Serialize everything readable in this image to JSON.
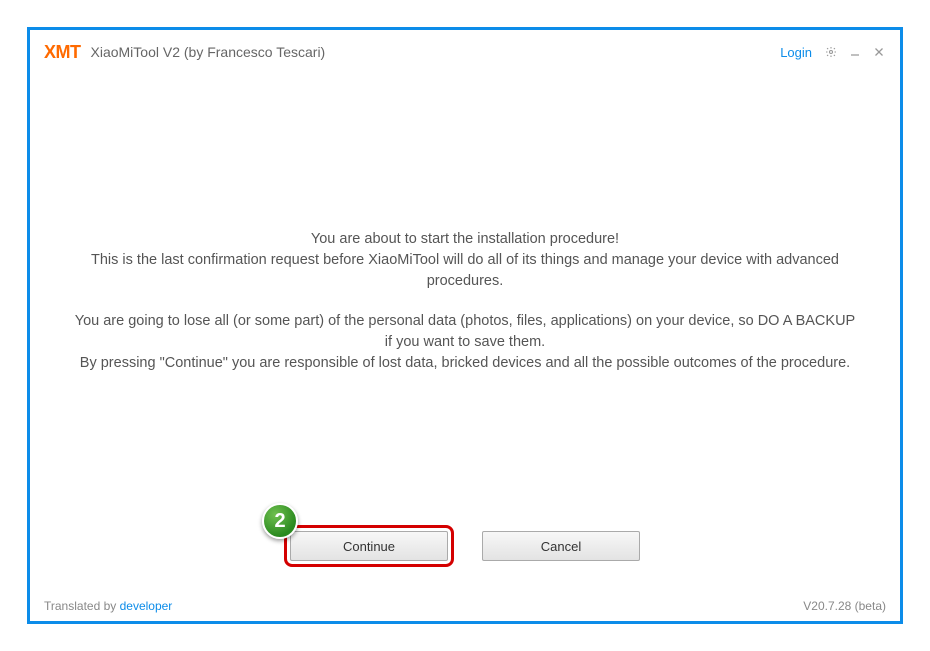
{
  "titlebar": {
    "logo": "XMT",
    "title": "XiaoMiTool V2 (by Francesco Tescari)",
    "login": "Login"
  },
  "message": {
    "line1": "You are about to start the installation procedure!",
    "line2": "This is the last confirmation request before XiaoMiTool will do all of its things and manage your device with advanced procedures.",
    "line3": "You are going to lose all (or some part) of the personal data (photos, files, applications) on your device, so DO A BACKUP if you want to save them.",
    "line4": "By pressing \"Continue\" you are responsible of lost data, bricked devices and all the possible outcomes of the procedure."
  },
  "buttons": {
    "continue": "Continue",
    "cancel": "Cancel"
  },
  "annotation": {
    "step": "2"
  },
  "footer": {
    "translated_prefix": "Translated by ",
    "translated_link": "developer",
    "version": "V20.7.28 (beta)"
  }
}
